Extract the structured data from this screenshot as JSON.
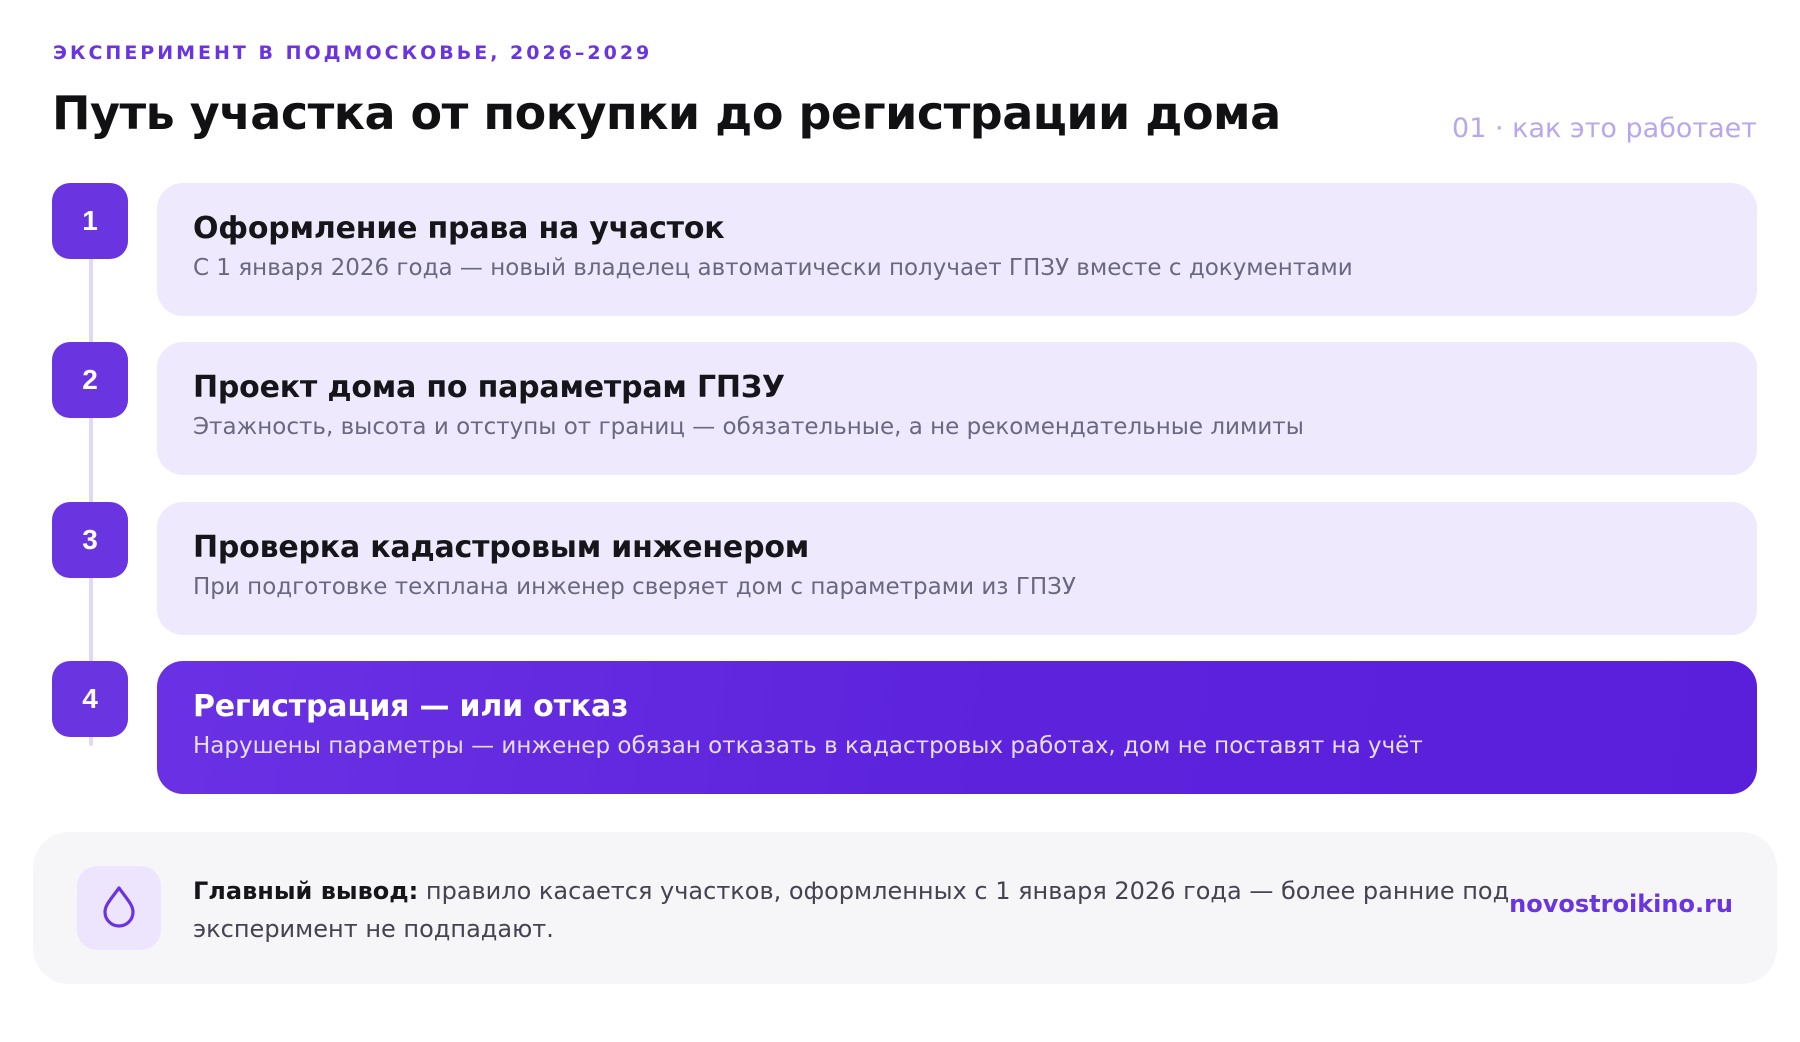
{
  "header": {
    "eyebrow": "ЭКСПЕРИМЕНТ В ПОДМОСКОВЬЕ, 2026–2029",
    "title": "Путь участка от покупки до регистрации дома",
    "section_tag": "01 · как это работает"
  },
  "steps": [
    {
      "number": "1",
      "title": "Оформление права на участок",
      "description": "С 1 января 2026 года — новый владелец автоматически получает ГПЗУ вместе с документами"
    },
    {
      "number": "2",
      "title": "Проект дома по параметрам ГПЗУ",
      "description": "Этажность, высота и отступы от границ — обязательные, а не рекомендательные лимиты"
    },
    {
      "number": "3",
      "title": "Проверка кадастровым инженером",
      "description": "При подготовке техплана инженер сверяет дом с параметрами из ГПЗУ"
    },
    {
      "number": "4",
      "title": "Регистрация — или отказ",
      "description": "Нарушены параметры — инженер обязан отказать в кадастровых работах, дом не поставят на учёт"
    }
  ],
  "summary": {
    "icon": "drop-icon",
    "lead": "Главный вывод:",
    "text": " правило касается участков, оформленных с 1 января 2026 года — более ранние под эксперимент не подпадают.",
    "site": "novostroikino.ru"
  },
  "colors": {
    "accent": "#6a35e0",
    "card_bg": "#efe9fd",
    "highlight_card": "#5c22dc",
    "summary_bg": "#f6f6f9",
    "muted_tag": "#b8a7ea"
  }
}
